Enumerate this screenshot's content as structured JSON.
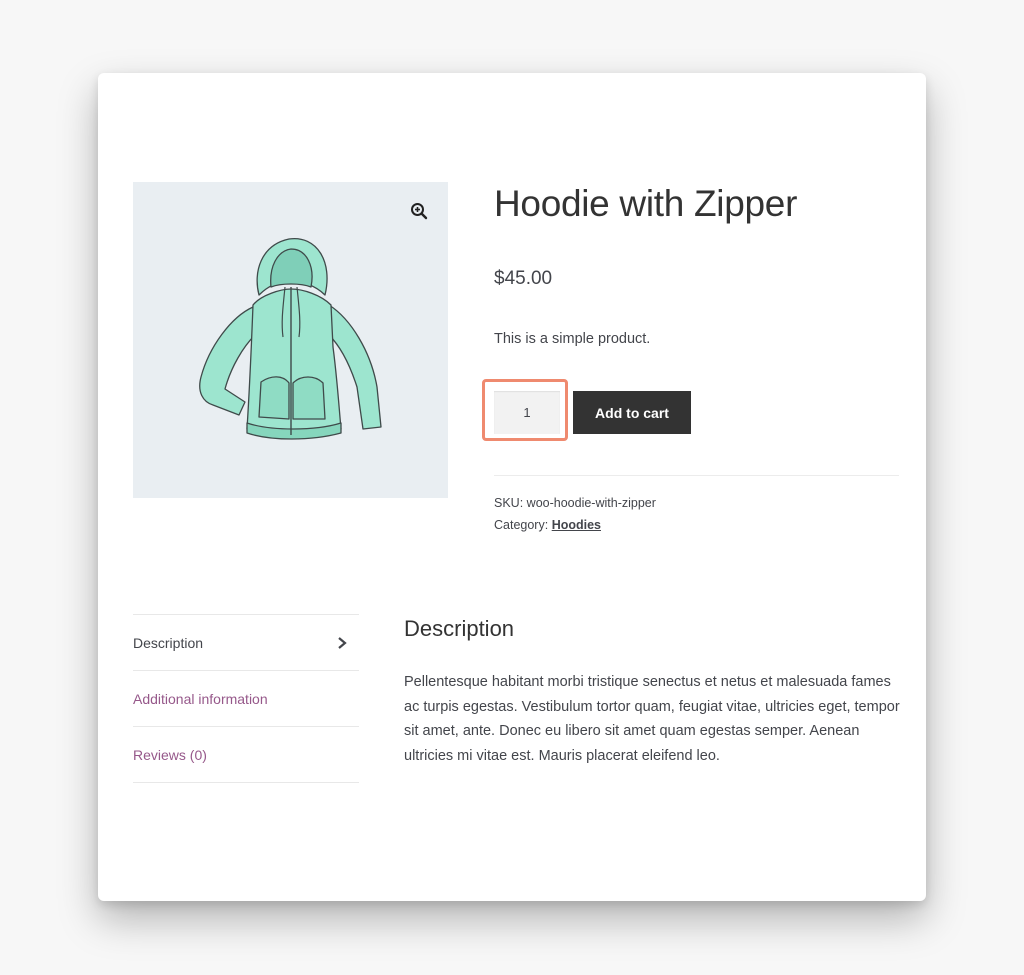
{
  "product": {
    "title": "Hoodie with Zipper",
    "price": "$45.00",
    "short_description": "This is a simple product.",
    "quantity": "1",
    "add_to_cart_label": "Add to cart",
    "sku_label": "SKU:",
    "sku_value": "woo-hoodie-with-zipper",
    "category_label": "Category:",
    "category_value": "Hoodies",
    "image_icon": "zoom-in-icon"
  },
  "tabs": [
    {
      "label": "Description",
      "active": true
    },
    {
      "label": "Additional information",
      "active": false
    },
    {
      "label": "Reviews (0)",
      "active": false
    }
  ],
  "panel": {
    "title": "Description",
    "text": "Pellentesque habitant morbi tristique senectus et netus et malesuada fames ac turpis egestas. Vestibulum tortor quam, feugiat vitae, ultricies eget, tempor sit amet, ante. Donec eu libero sit amet quam egestas semper. Aenean ultricies mi vitae est. Mauris placerat eleifend leo."
  },
  "colors": {
    "accent": "#96588a",
    "button": "#333333",
    "highlight": "#ef8a6f",
    "hoodie": "#9de5cf"
  }
}
